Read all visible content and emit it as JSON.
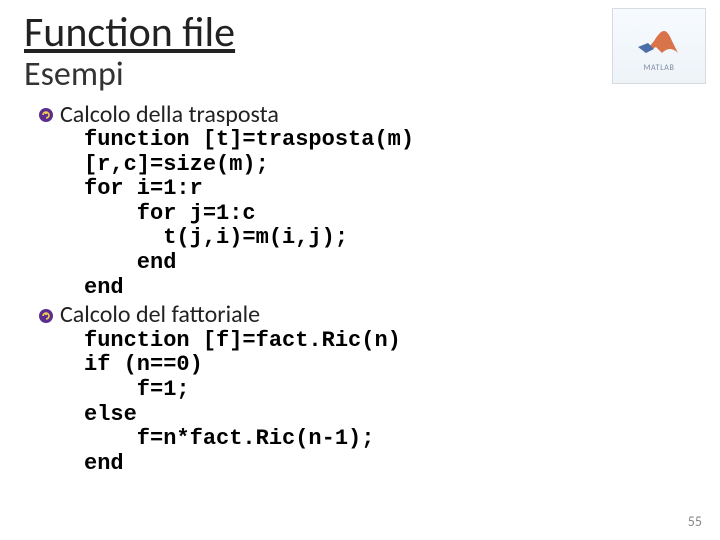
{
  "header": {
    "title": "Function file",
    "subtitle": "Esempi",
    "logo_label": "MATLAB"
  },
  "sections": [
    {
      "heading": "Calcolo della trasposta",
      "code": "function [t]=trasposta(m)\n[r,c]=size(m);\nfor i=1:r\n    for j=1:c\n      t(j,i)=m(i,j);\n    end\nend"
    },
    {
      "heading": "Calcolo del fattoriale",
      "code": "function [f]=fact.Ric(n)\nif (n==0)\n    f=1;\nelse\n    f=n*fact.Ric(n-1);\nend"
    }
  ],
  "page_number": "55"
}
